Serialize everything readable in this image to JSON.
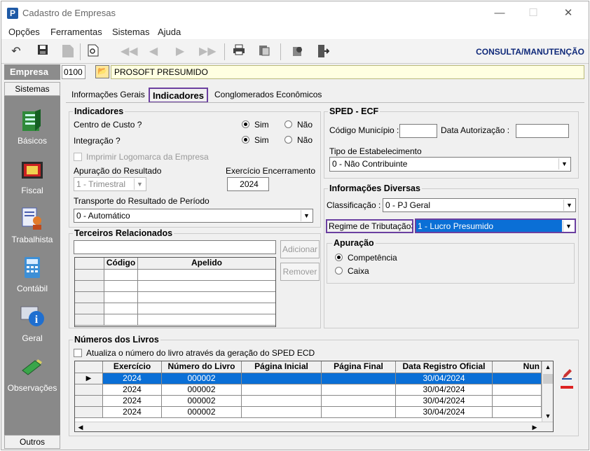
{
  "window": {
    "title": "Cadastro de Empresas",
    "minimize": "—",
    "maximize": "☐",
    "close": "✕"
  },
  "menu": [
    "Opções",
    "Ferramentas",
    "Sistemas",
    "Ajuda"
  ],
  "toolbar": {
    "mode": "CONSULTA/MANUTENÇÃO"
  },
  "empresa": {
    "label": "Empresa",
    "code": "0100",
    "name": "PROSOFT PRESUMIDO"
  },
  "sidebar": {
    "header": "Sistemas",
    "footer": "Outros",
    "items": [
      "Básicos",
      "Fiscal",
      "Trabalhista",
      "Contábil",
      "Geral",
      "Observações"
    ]
  },
  "tabs": [
    "Informações Gerais",
    "Indicadores",
    "Conglomerados Econômicos"
  ],
  "indicadores": {
    "title": "Indicadores",
    "centro_custo": "Centro de Custo ?",
    "integracao": "Integração ?",
    "sim": "Sim",
    "nao": "Não",
    "imprimir_logo": "Imprimir Logomarca da Empresa",
    "apuracao_resultado": "Apuração do Resultado",
    "apuracao_value": "1 - Trimestral",
    "exercicio_label": "Exercício Encerramento",
    "exercicio_value": "2024",
    "transporte_label": "Transporte do Resultado de Período",
    "transporte_value": "0 - Automático"
  },
  "terceiros": {
    "title": "Terceiros Relacionados",
    "add": "Adicionar",
    "remove": "Remover",
    "columns": [
      "Código",
      "Apelido"
    ]
  },
  "sped": {
    "title": "SPED - ECF",
    "codigo_municipio": "Código Município :",
    "data_autorizacao": "Data Autorização :",
    "tipo_label": "Tipo de Estabelecimento",
    "tipo_value": "0 - Não Contribuinte"
  },
  "info": {
    "title": "Informações Diversas",
    "classificacao_label": "Classificação :",
    "classificacao_value": "0 - PJ Geral",
    "regime_label": "Regime de Tributação",
    "regime_colon": ":",
    "regime_value": "1 - Lucro Presumido"
  },
  "apuracao": {
    "title": "Apuração",
    "competencia": "Competência",
    "caixa": "Caixa"
  },
  "livros": {
    "title": "Números dos Livros",
    "atualiza": "Atualiza o número do livro através da geração do SPED ECD",
    "columns": [
      "Exercício",
      "Número do Livro",
      "Página Inicial",
      "Página Final",
      "Data Registro Oficial",
      "Nun"
    ],
    "rows": [
      [
        "2024",
        "000002",
        "",
        "",
        "30/04/2024",
        ""
      ],
      [
        "2024",
        "000002",
        "",
        "",
        "30/04/2024",
        ""
      ],
      [
        "2024",
        "000002",
        "",
        "",
        "30/04/2024",
        ""
      ],
      [
        "2024",
        "000002",
        "",
        "",
        "30/04/2024",
        ""
      ]
    ]
  },
  "colors": {
    "accent": "#6b3fa0",
    "selection": "#0a6fd6",
    "header_text": "#102a7a"
  }
}
